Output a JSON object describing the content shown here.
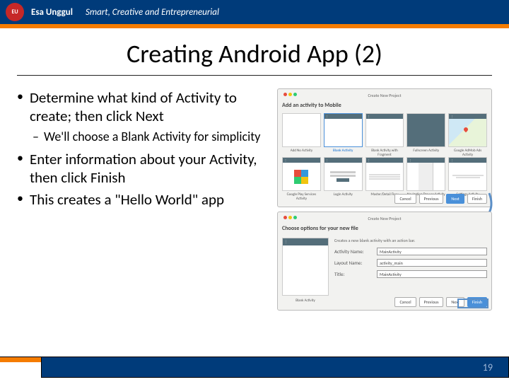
{
  "header": {
    "logo_text": "EU",
    "university": "Esa Unggul",
    "tagline": "Smart, Creative and Entrepreneurial"
  },
  "slide": {
    "title": "Creating Android App (2)",
    "bullets": [
      {
        "level": 1,
        "text": "Determine what kind of Activity to create; then click Next"
      },
      {
        "level": 2,
        "text": "We'll choose a Blank Activity for simplicity"
      },
      {
        "level": 1,
        "text": "Enter information about your Activity, then click Finish"
      },
      {
        "level": 1,
        "text": "This creates a \"Hello World\" app"
      }
    ],
    "page_number": "19"
  },
  "screenshot1": {
    "window_title": "Create New Project",
    "heading": "Add an activity to Mobile",
    "templates": [
      "Add No Activity",
      "Blank Activity",
      "Blank Activity with Fragment",
      "Fullscreen Activity",
      "Google AdMob Ads Activity",
      "Google Play Services Activity",
      "Login Activity",
      "Master/Detail Flow",
      "Navigation Drawer Activity",
      "Settings Activity"
    ],
    "selected_template": "Blank Activity",
    "buttons": {
      "cancel": "Cancel",
      "prev": "Previous",
      "next": "Next",
      "finish": "Finish"
    }
  },
  "screenshot2": {
    "window_title": "Create New Project",
    "heading": "Choose options for your new file",
    "subheading": "Creates a new blank activity with an action bar.",
    "fields": {
      "activity_name": {
        "label": "Activity Name:",
        "value": "MainActivity"
      },
      "layout_name": {
        "label": "Layout Name:",
        "value": "activity_main"
      },
      "title": {
        "label": "Title:",
        "value": "MainActivity"
      }
    },
    "preview_label": "Blank Activity",
    "buttons": {
      "cancel": "Cancel",
      "prev": "Previous",
      "next": "Next",
      "finish": "Finish"
    }
  }
}
